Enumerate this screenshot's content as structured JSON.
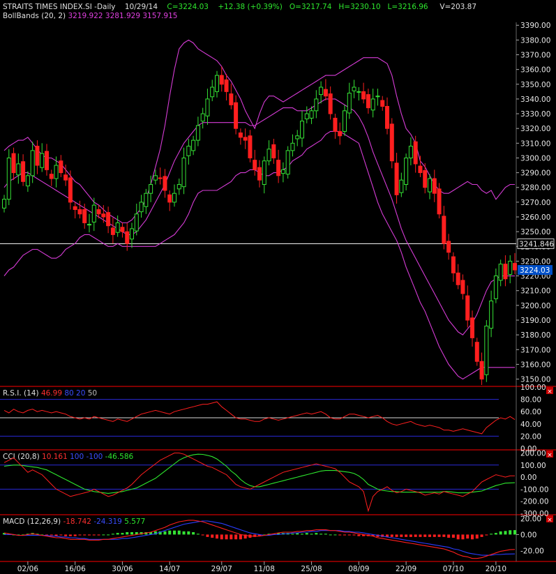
{
  "header": {
    "symbol": "STRAITS TIMES INDEX.SI -Daily",
    "date": "10/29/14",
    "close": "C=3224.03",
    "change": "+12.38 (+0.39%)",
    "open": "O=3217.74",
    "high": "H=3230.10",
    "low": "L=3216.96",
    "volume": "V=203.87"
  },
  "bollinger_legend": {
    "label": "BollBands (20, 2)",
    "values": "3219.922 3281.929 3157.915"
  },
  "rsi_legend": {
    "label": "R.S.I. (14)",
    "value": "46.99",
    "levels": "80 20",
    "mid": "50"
  },
  "cci_legend": {
    "label": "CCI (20,8)",
    "value": "10.161",
    "levels": "100 -100",
    "signal": "-46.586"
  },
  "macd_legend": {
    "label": "MACD (12,26,9)",
    "macd": "-18.742",
    "signal": "-24.319",
    "hist": "5.577"
  },
  "colors": {
    "background": "#000000",
    "up": "#35e335",
    "down": "#ff1f1f",
    "bollinger": "#d63cd6",
    "panel_border": "#cc0000",
    "axis_text": "#e8e8e8",
    "level_line": "#2a2ad8",
    "signal_line": "#2ee82e"
  },
  "chart_data": [
    {
      "type": "candlestick",
      "title": "STRAITS TIMES INDEX.SI -Daily",
      "y_ticks": [
        "3150.00",
        "3160.00",
        "3170.00",
        "3180.00",
        "3190.00",
        "3200.00",
        "3210.00",
        "3220.00",
        "3230.00",
        "3240.00",
        "3250.00",
        "3260.00",
        "3270.00",
        "3280.00",
        "3290.00",
        "3300.00",
        "3310.00",
        "3320.00",
        "3330.00",
        "3340.00",
        "3350.00",
        "3360.00",
        "3370.00",
        "3380.00",
        "3390.00"
      ],
      "ylim": [
        3146,
        3392
      ],
      "x_ticks": [
        "02/06",
        "16/06",
        "30/06",
        "14/07",
        "29/07",
        "11/08",
        "25/08",
        "08/09",
        "22/09",
        "07/10",
        "20/10"
      ],
      "x_tick_index": [
        5,
        15,
        25,
        35,
        46,
        55,
        65,
        75,
        85,
        95,
        104
      ],
      "horizontal_line": {
        "value": 3241.846,
        "label": "3241.846"
      },
      "last_price_label": "3224.03",
      "closes": [
        3272,
        3300,
        3290,
        3296,
        3284,
        3288,
        3305,
        3295,
        3303,
        3292,
        3286,
        3295,
        3290,
        3285,
        3270,
        3265,
        3262,
        3256,
        3255,
        3268,
        3262,
        3260,
        3254,
        3248,
        3256,
        3250,
        3242,
        3252,
        3262,
        3270,
        3276,
        3282,
        3288,
        3286,
        3278,
        3270,
        3276,
        3282,
        3300,
        3308,
        3312,
        3322,
        3330,
        3340,
        3348,
        3356,
        3350,
        3345,
        3336,
        3320,
        3314,
        3312,
        3300,
        3292,
        3285,
        3298,
        3306,
        3300,
        3288,
        3292,
        3305,
        3310,
        3315,
        3325,
        3330,
        3332,
        3340,
        3348,
        3342,
        3330,
        3318,
        3315,
        3332,
        3344,
        3348,
        3345,
        3340,
        3334,
        3340,
        3342,
        3335,
        3320,
        3298,
        3275,
        3285,
        3300,
        3308,
        3296,
        3290,
        3280,
        3286,
        3276,
        3262,
        3242,
        3236,
        3222,
        3214,
        3208,
        3190,
        3178,
        3162,
        3150,
        3186,
        3203,
        3220,
        3228,
        3218,
        3230,
        3224.03
      ],
      "bb_upper": [
        3305,
        3308,
        3310,
        3312,
        3312,
        3314,
        3310,
        3306,
        3302,
        3300,
        3300,
        3298,
        3296,
        3292,
        3288,
        3284,
        3282,
        3278,
        3274,
        3270,
        3268,
        3265,
        3262,
        3260,
        3258,
        3256,
        3256,
        3258,
        3262,
        3266,
        3272,
        3282,
        3294,
        3306,
        3322,
        3342,
        3360,
        3374,
        3378,
        3380,
        3378,
        3374,
        3372,
        3370,
        3368,
        3366,
        3362,
        3356,
        3352,
        3346,
        3340,
        3332,
        3326,
        3320,
        3330,
        3338,
        3342,
        3342,
        3340,
        3338,
        3340,
        3342,
        3344,
        3346,
        3348,
        3350,
        3352,
        3354,
        3356,
        3356,
        3356,
        3358,
        3360,
        3362,
        3364,
        3366,
        3368,
        3368,
        3368,
        3368,
        3366,
        3364,
        3356,
        3342,
        3330,
        3320,
        3316,
        3310,
        3298,
        3294,
        3288,
        3282,
        3278,
        3276,
        3276,
        3278,
        3280,
        3282,
        3284,
        3282,
        3282,
        3278,
        3276,
        3278,
        3272,
        3276,
        3280,
        3282,
        3282
      ],
      "bb_middle": [
        3280,
        3284,
        3286,
        3288,
        3290,
        3290,
        3288,
        3286,
        3284,
        3282,
        3280,
        3278,
        3276,
        3274,
        3272,
        3270,
        3268,
        3266,
        3264,
        3262,
        3260,
        3258,
        3256,
        3254,
        3252,
        3250,
        3248,
        3248,
        3250,
        3254,
        3258,
        3264,
        3270,
        3276,
        3282,
        3290,
        3298,
        3304,
        3310,
        3314,
        3318,
        3322,
        3324,
        3324,
        3324,
        3324,
        3324,
        3324,
        3324,
        3324,
        3324,
        3324,
        3322,
        3322,
        3324,
        3326,
        3328,
        3330,
        3332,
        3334,
        3334,
        3334,
        3332,
        3332,
        3332,
        3334,
        3336,
        3338,
        3340,
        3340,
        3340,
        3338,
        3336,
        3334,
        3332,
        3328,
        3322,
        3314,
        3304,
        3296,
        3288,
        3280,
        3272,
        3262,
        3252,
        3244,
        3238,
        3232,
        3226,
        3220,
        3214,
        3208,
        3202,
        3196,
        3190,
        3186,
        3182,
        3180,
        3184,
        3188,
        3194,
        3202,
        3210,
        3216,
        3218,
        3220,
        3220,
        3220,
        3219.922
      ],
      "bb_lower": [
        3220,
        3224,
        3226,
        3230,
        3234,
        3236,
        3238,
        3238,
        3236,
        3234,
        3232,
        3232,
        3234,
        3238,
        3240,
        3242,
        3246,
        3248,
        3248,
        3246,
        3244,
        3242,
        3240,
        3240,
        3242,
        3240,
        3240,
        3240,
        3240,
        3240,
        3240,
        3240,
        3240,
        3242,
        3244,
        3246,
        3248,
        3252,
        3256,
        3262,
        3270,
        3276,
        3278,
        3278,
        3278,
        3278,
        3280,
        3282,
        3284,
        3288,
        3290,
        3290,
        3292,
        3292,
        3290,
        3288,
        3288,
        3290,
        3290,
        3292,
        3294,
        3298,
        3300,
        3302,
        3306,
        3308,
        3310,
        3312,
        3316,
        3318,
        3318,
        3318,
        3316,
        3314,
        3312,
        3310,
        3300,
        3290,
        3280,
        3270,
        3262,
        3256,
        3250,
        3244,
        3236,
        3226,
        3218,
        3210,
        3202,
        3196,
        3188,
        3180,
        3172,
        3166,
        3160,
        3156,
        3152,
        3150,
        3152,
        3154,
        3156,
        3158,
        3157.915,
        3157.915,
        3157.915,
        3157.915,
        3157.915,
        3157.915,
        3157.915
      ]
    },
    {
      "type": "line",
      "title": "R.S.I. (14)",
      "y_ticks": [
        "0.00",
        "20.00",
        "40.00",
        "60.00",
        "80.00",
        "100.00"
      ],
      "ylim": [
        0,
        100
      ],
      "levels": [
        20,
        50,
        80
      ],
      "values": [
        62,
        58,
        64,
        60,
        58,
        62,
        64,
        60,
        62,
        60,
        58,
        60,
        58,
        56,
        52,
        50,
        48,
        50,
        48,
        52,
        50,
        48,
        46,
        44,
        48,
        46,
        44,
        48,
        52,
        56,
        58,
        60,
        62,
        60,
        58,
        56,
        60,
        62,
        64,
        66,
        68,
        70,
        72,
        72,
        74,
        76,
        68,
        62,
        56,
        50,
        48,
        48,
        46,
        44,
        44,
        48,
        50,
        48,
        46,
        48,
        50,
        52,
        54,
        56,
        58,
        56,
        58,
        60,
        56,
        50,
        48,
        48,
        52,
        56,
        56,
        54,
        52,
        50,
        52,
        54,
        50,
        44,
        40,
        38,
        40,
        42,
        44,
        40,
        38,
        36,
        38,
        36,
        34,
        30,
        30,
        28,
        30,
        32,
        30,
        28,
        26,
        24,
        34,
        40,
        46,
        50,
        48,
        52,
        46.99
      ]
    },
    {
      "type": "line",
      "title": "CCI (20,8)",
      "y_ticks": [
        "-300.00",
        "-200.00",
        "-100.00",
        "0.00",
        "100.00",
        "200.00"
      ],
      "ylim": [
        -300,
        220
      ],
      "levels": [
        100,
        -100
      ],
      "cci": [
        120,
        140,
        160,
        120,
        80,
        40,
        60,
        40,
        20,
        -20,
        -60,
        -100,
        -120,
        -140,
        -160,
        -150,
        -140,
        -130,
        -120,
        -100,
        -120,
        -140,
        -160,
        -150,
        -130,
        -110,
        -90,
        -60,
        -20,
        20,
        50,
        80,
        110,
        140,
        160,
        180,
        200,
        200,
        190,
        170,
        150,
        130,
        110,
        90,
        80,
        60,
        40,
        20,
        -20,
        -60,
        -80,
        -90,
        -100,
        -80,
        -60,
        -40,
        -20,
        0,
        20,
        40,
        50,
        60,
        70,
        80,
        90,
        100,
        110,
        100,
        90,
        80,
        70,
        40,
        0,
        -40,
        -60,
        -80,
        -120,
        -280,
        -160,
        -120,
        -100,
        -80,
        -110,
        -130,
        -120,
        -100,
        -110,
        -120,
        -130,
        -150,
        -140,
        -130,
        -140,
        -120,
        -130,
        -140,
        -150,
        -160,
        -140,
        -120,
        -80,
        -40,
        -20,
        0,
        20,
        10,
        0,
        10,
        10.161
      ],
      "signal": [
        90,
        95,
        100,
        100,
        95,
        90,
        85,
        80,
        70,
        60,
        40,
        20,
        0,
        -20,
        -40,
        -60,
        -80,
        -100,
        -110,
        -120,
        -125,
        -130,
        -135,
        -130,
        -125,
        -120,
        -110,
        -100,
        -90,
        -70,
        -50,
        -30,
        -10,
        20,
        50,
        80,
        110,
        140,
        160,
        175,
        185,
        190,
        188,
        180,
        170,
        150,
        120,
        90,
        50,
        20,
        -20,
        -50,
        -70,
        -80,
        -80,
        -70,
        -60,
        -50,
        -40,
        -30,
        -20,
        -10,
        0,
        10,
        20,
        30,
        40,
        50,
        55,
        55,
        55,
        50,
        45,
        40,
        30,
        10,
        -20,
        -60,
        -80,
        -100,
        -110,
        -115,
        -120,
        -120,
        -125,
        -125,
        -125,
        -125,
        -125,
        -125,
        -125,
        -125,
        -125,
        -120,
        -120,
        -125,
        -130,
        -130,
        -130,
        -125,
        -120,
        -115,
        -100,
        -85,
        -70,
        -60,
        -50,
        -48,
        -46.586
      ]
    },
    {
      "type": "line",
      "title": "MACD (12,26,9)",
      "y_ticks": [
        "-20.00",
        "0.00",
        "20.00"
      ],
      "ylim": [
        -32,
        24
      ],
      "macd": [
        2,
        1,
        0,
        -1,
        -1,
        0,
        1,
        0,
        -1,
        -2,
        -3,
        -4,
        -4,
        -5,
        -6,
        -6,
        -6,
        -6,
        -7,
        -7,
        -7,
        -6,
        -6,
        -5,
        -4,
        -3,
        -2,
        -1,
        0,
        1,
        2,
        3,
        5,
        7,
        9,
        12,
        14,
        16,
        17,
        18,
        18,
        17,
        16,
        14,
        12,
        10,
        8,
        6,
        4,
        2,
        0,
        -1,
        -2,
        -2,
        -2,
        -1,
        0,
        1,
        2,
        3,
        3,
        3,
        4,
        4,
        5,
        5,
        6,
        6,
        6,
        5,
        5,
        4,
        3,
        3,
        2,
        1,
        0,
        -1,
        -2,
        -4,
        -5,
        -6,
        -7,
        -8,
        -9,
        -10,
        -11,
        -12,
        -13,
        -14,
        -15,
        -16,
        -17,
        -18,
        -20,
        -22,
        -25,
        -27,
        -28,
        -30,
        -30,
        -29,
        -27,
        -25,
        -23,
        -21,
        -20,
        -19,
        -18.742
      ],
      "signal": [
        0,
        0,
        0,
        -1,
        -1,
        -1,
        -1,
        -1,
        -1,
        -1,
        -2,
        -2,
        -3,
        -3,
        -4,
        -4,
        -5,
        -5,
        -6,
        -6,
        -6,
        -6,
        -6,
        -6,
        -6,
        -5,
        -5,
        -4,
        -3,
        -2,
        -1,
        0,
        1,
        3,
        5,
        7,
        9,
        11,
        13,
        14,
        15,
        16,
        17,
        17,
        16,
        15,
        14,
        12,
        10,
        8,
        6,
        4,
        2,
        1,
        0,
        -1,
        -1,
        0,
        0,
        1,
        1,
        2,
        2,
        3,
        3,
        4,
        4,
        5,
        5,
        5,
        5,
        5,
        4,
        4,
        3,
        3,
        2,
        1,
        0,
        -1,
        -2,
        -3,
        -4,
        -5,
        -6,
        -7,
        -8,
        -9,
        -10,
        -11,
        -12,
        -13,
        -14,
        -15,
        -16,
        -18,
        -19,
        -21,
        -23,
        -24,
        -25,
        -26,
        -26,
        -26,
        -25,
        -25,
        -24.5,
        -24.4,
        -24.319
      ]
    }
  ]
}
